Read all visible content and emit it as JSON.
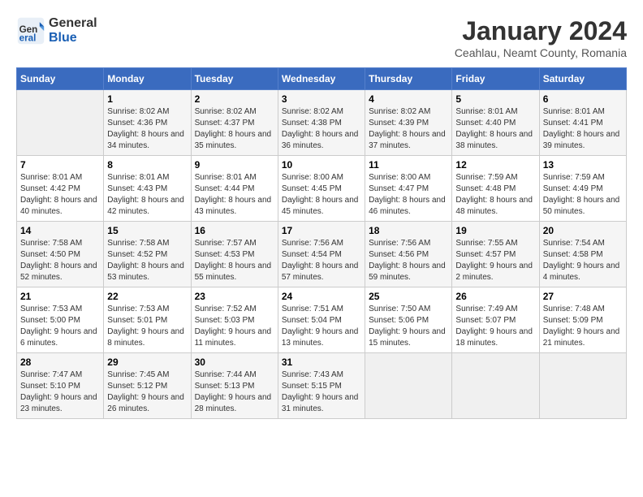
{
  "logo": {
    "line1": "General",
    "line2": "Blue"
  },
  "title": "January 2024",
  "subtitle": "Ceahlau, Neamt County, Romania",
  "days_of_week": [
    "Sunday",
    "Monday",
    "Tuesday",
    "Wednesday",
    "Thursday",
    "Friday",
    "Saturday"
  ],
  "weeks": [
    [
      {
        "day": "",
        "empty": true
      },
      {
        "day": "1",
        "sunrise": "8:02 AM",
        "sunset": "4:36 PM",
        "daylight": "8 hours and 34 minutes."
      },
      {
        "day": "2",
        "sunrise": "8:02 AM",
        "sunset": "4:37 PM",
        "daylight": "8 hours and 35 minutes."
      },
      {
        "day": "3",
        "sunrise": "8:02 AM",
        "sunset": "4:38 PM",
        "daylight": "8 hours and 36 minutes."
      },
      {
        "day": "4",
        "sunrise": "8:02 AM",
        "sunset": "4:39 PM",
        "daylight": "8 hours and 37 minutes."
      },
      {
        "day": "5",
        "sunrise": "8:01 AM",
        "sunset": "4:40 PM",
        "daylight": "8 hours and 38 minutes."
      },
      {
        "day": "6",
        "sunrise": "8:01 AM",
        "sunset": "4:41 PM",
        "daylight": "8 hours and 39 minutes."
      }
    ],
    [
      {
        "day": "7",
        "sunrise": "8:01 AM",
        "sunset": "4:42 PM",
        "daylight": "8 hours and 40 minutes."
      },
      {
        "day": "8",
        "sunrise": "8:01 AM",
        "sunset": "4:43 PM",
        "daylight": "8 hours and 42 minutes."
      },
      {
        "day": "9",
        "sunrise": "8:01 AM",
        "sunset": "4:44 PM",
        "daylight": "8 hours and 43 minutes."
      },
      {
        "day": "10",
        "sunrise": "8:00 AM",
        "sunset": "4:45 PM",
        "daylight": "8 hours and 45 minutes."
      },
      {
        "day": "11",
        "sunrise": "8:00 AM",
        "sunset": "4:47 PM",
        "daylight": "8 hours and 46 minutes."
      },
      {
        "day": "12",
        "sunrise": "7:59 AM",
        "sunset": "4:48 PM",
        "daylight": "8 hours and 48 minutes."
      },
      {
        "day": "13",
        "sunrise": "7:59 AM",
        "sunset": "4:49 PM",
        "daylight": "8 hours and 50 minutes."
      }
    ],
    [
      {
        "day": "14",
        "sunrise": "7:58 AM",
        "sunset": "4:50 PM",
        "daylight": "8 hours and 52 minutes."
      },
      {
        "day": "15",
        "sunrise": "7:58 AM",
        "sunset": "4:52 PM",
        "daylight": "8 hours and 53 minutes."
      },
      {
        "day": "16",
        "sunrise": "7:57 AM",
        "sunset": "4:53 PM",
        "daylight": "8 hours and 55 minutes."
      },
      {
        "day": "17",
        "sunrise": "7:56 AM",
        "sunset": "4:54 PM",
        "daylight": "8 hours and 57 minutes."
      },
      {
        "day": "18",
        "sunrise": "7:56 AM",
        "sunset": "4:56 PM",
        "daylight": "8 hours and 59 minutes."
      },
      {
        "day": "19",
        "sunrise": "7:55 AM",
        "sunset": "4:57 PM",
        "daylight": "9 hours and 2 minutes."
      },
      {
        "day": "20",
        "sunrise": "7:54 AM",
        "sunset": "4:58 PM",
        "daylight": "9 hours and 4 minutes."
      }
    ],
    [
      {
        "day": "21",
        "sunrise": "7:53 AM",
        "sunset": "5:00 PM",
        "daylight": "9 hours and 6 minutes."
      },
      {
        "day": "22",
        "sunrise": "7:53 AM",
        "sunset": "5:01 PM",
        "daylight": "9 hours and 8 minutes."
      },
      {
        "day": "23",
        "sunrise": "7:52 AM",
        "sunset": "5:03 PM",
        "daylight": "9 hours and 11 minutes."
      },
      {
        "day": "24",
        "sunrise": "7:51 AM",
        "sunset": "5:04 PM",
        "daylight": "9 hours and 13 minutes."
      },
      {
        "day": "25",
        "sunrise": "7:50 AM",
        "sunset": "5:06 PM",
        "daylight": "9 hours and 15 minutes."
      },
      {
        "day": "26",
        "sunrise": "7:49 AM",
        "sunset": "5:07 PM",
        "daylight": "9 hours and 18 minutes."
      },
      {
        "day": "27",
        "sunrise": "7:48 AM",
        "sunset": "5:09 PM",
        "daylight": "9 hours and 21 minutes."
      }
    ],
    [
      {
        "day": "28",
        "sunrise": "7:47 AM",
        "sunset": "5:10 PM",
        "daylight": "9 hours and 23 minutes."
      },
      {
        "day": "29",
        "sunrise": "7:45 AM",
        "sunset": "5:12 PM",
        "daylight": "9 hours and 26 minutes."
      },
      {
        "day": "30",
        "sunrise": "7:44 AM",
        "sunset": "5:13 PM",
        "daylight": "9 hours and 28 minutes."
      },
      {
        "day": "31",
        "sunrise": "7:43 AM",
        "sunset": "5:15 PM",
        "daylight": "9 hours and 31 minutes."
      },
      {
        "day": "",
        "empty": true
      },
      {
        "day": "",
        "empty": true
      },
      {
        "day": "",
        "empty": true
      }
    ]
  ]
}
